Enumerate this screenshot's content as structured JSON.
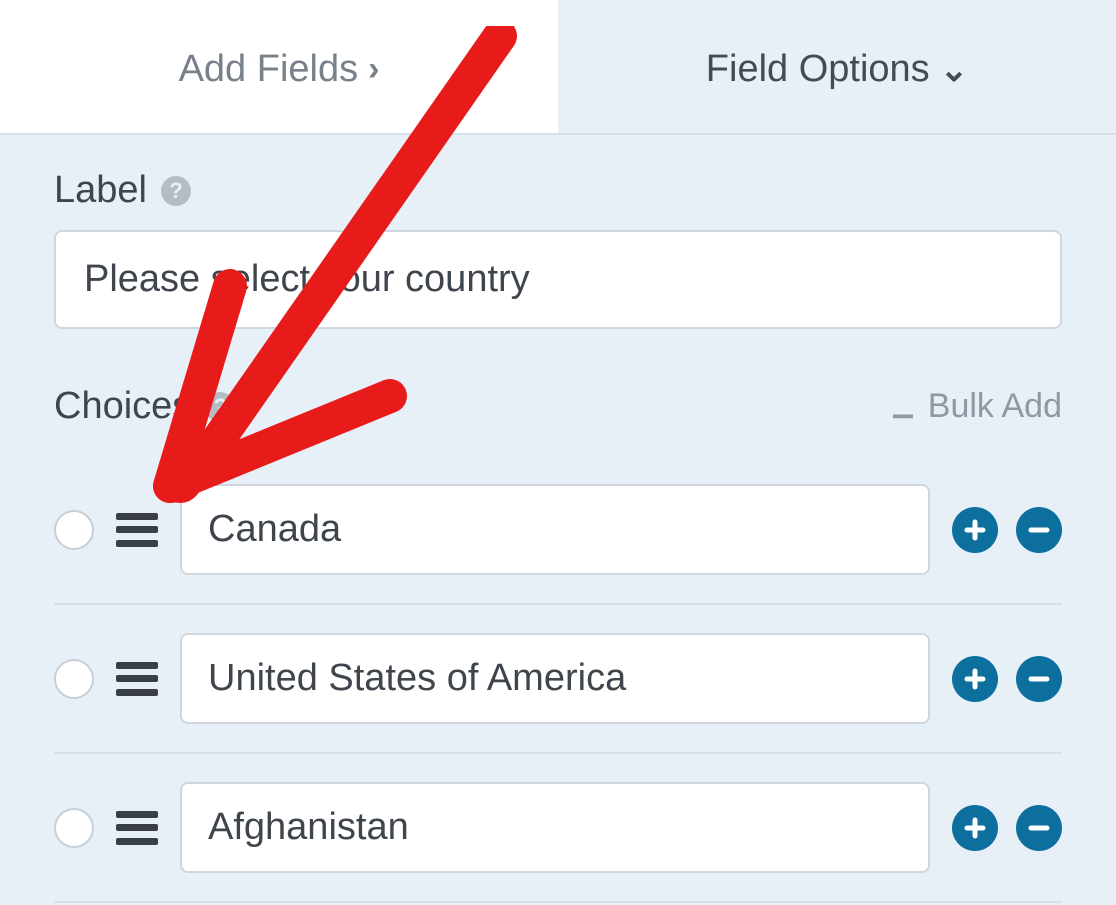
{
  "tabs": {
    "add_fields": "Add Fields",
    "field_options": "Field Options"
  },
  "label_section": {
    "title": "Label",
    "value": "Please select your country"
  },
  "choices_section": {
    "title": "Choices",
    "bulk_add": "Bulk Add"
  },
  "choices": [
    {
      "value": "Canada"
    },
    {
      "value": "United States of America"
    },
    {
      "value": "Afghanistan"
    }
  ]
}
